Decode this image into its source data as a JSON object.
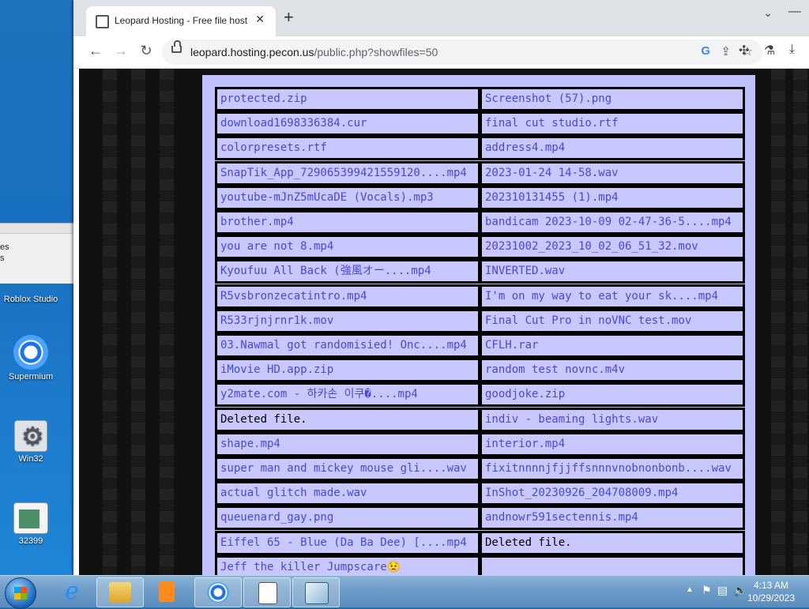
{
  "desktop": {
    "bg_window": {
      "line1": "es",
      "line2": "s"
    },
    "icons": [
      {
        "label": "Roblox Studio"
      },
      {
        "label": "Supermium"
      },
      {
        "label": "Win32"
      },
      {
        "label": "32399"
      }
    ]
  },
  "browser": {
    "tab": {
      "title": "Leopard Hosting - Free file host",
      "close": "✕"
    },
    "new_tab": "+",
    "url": {
      "host": "leopard.hosting.pecon.us",
      "path": "/public.php?showfiles=50"
    },
    "nav": {
      "back": "←",
      "forward": "→",
      "reload": "↻"
    }
  },
  "files": {
    "left": [
      "protected.zip",
      "download1698336384.cur",
      "colorpresets.rtf",
      "SnapTik_App_729065399421559120....mp4",
      "youtube-mJnZ5mUcaDE (Vocals).mp3",
      "brother.mp4",
      "you are not 8.mp4",
      "Kyoufuu All Back (強風オー....mp4",
      "R5vsbronzecatintro.mp4",
      "R533rjnjrnr1k.mov",
      "03.Nawmal got randomisied! Onc....mp4",
      "iMovie HD.app.zip",
      "y2mate.com - 하카손 이쿠�....mp4",
      "Deleted file.",
      "shape.mp4",
      "super man and mickey mouse gli....wav",
      "actual glitch made.wav",
      "queuenard_gay.png",
      "Eiffel 65 - Blue (Da Ba Dee) [....mp4",
      "Jeff the killer Jumpscare😟"
    ],
    "right": [
      "Screenshot (57).png",
      "final cut studio.rtf",
      "address4.mp4",
      "2023-01-24 14-58.wav",
      "202310131455 (1).mp4",
      "bandicam 2023-10-09 02-47-36-5....mp4",
      "20231002_2023_10_02_06_51_32.mov",
      "INVERTED.wav",
      "I'm on my way to eat your sk....mp4",
      "Final Cut Pro in noVNC test.mov",
      "CFLH.rar",
      "random test novnc.m4v",
      "goodjoke.zip",
      "indiv - beaming lights.wav",
      "interior.mp4",
      "fixitnnnnjfjjffsnnnvnobnonbonb....wav",
      "InShot_20230926_204708009.mp4",
      "andnowr591sectennis.mp4",
      "Deleted file.",
      ""
    ]
  },
  "taskbar": {
    "clock_time": "4:13 AM",
    "clock_date": "10/29/2023"
  }
}
